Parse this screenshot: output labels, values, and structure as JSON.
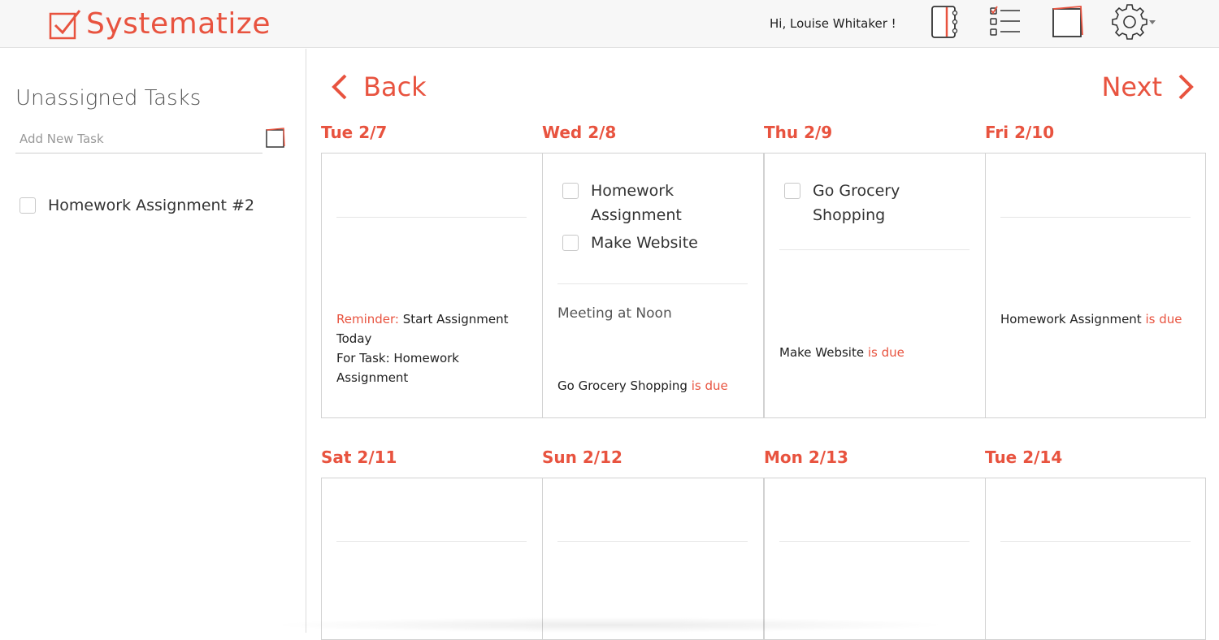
{
  "app": {
    "name": "Systematize",
    "greeting": "Hi, Louise Whitaker !",
    "accent_color": "#e8533f",
    "icons": [
      "notebook-icon",
      "checklist-icon",
      "sticky-note-icon",
      "settings-gear-icon"
    ]
  },
  "sidebar": {
    "title": "Unassigned Tasks",
    "add_placeholder": "Add New Task",
    "tasks": [
      {
        "label": "Homework Assignment #2",
        "checked": false
      }
    ]
  },
  "nav": {
    "back": "Back",
    "next": "Next"
  },
  "days": [
    {
      "label": "Tue 2/7",
      "tasks": [],
      "reminder_prefix": "Reminder:",
      "reminder_text": "Start Assignment Today",
      "reminder_task": "For Task: Homework Assignment"
    },
    {
      "label": "Wed 2/8",
      "tasks": [
        {
          "label": "Homework Assignment",
          "checked": false
        },
        {
          "label": "Make Website",
          "checked": false
        }
      ],
      "event": "Meeting at Noon",
      "due_item": "Go Grocery Shopping",
      "due_suffix": "is due"
    },
    {
      "label": "Thu 2/9",
      "tasks": [
        {
          "label": "Go Grocery Shopping",
          "checked": false
        }
      ],
      "due_item": "Make Website",
      "due_suffix": "is due"
    },
    {
      "label": "Fri 2/10",
      "tasks": [],
      "due_item": "Homework Assignment",
      "due_suffix": "is due"
    },
    {
      "label": "Sat 2/11",
      "tasks": []
    },
    {
      "label": "Sun 2/12",
      "tasks": []
    },
    {
      "label": "Mon 2/13",
      "tasks": []
    },
    {
      "label": "Tue 2/14",
      "tasks": []
    }
  ]
}
